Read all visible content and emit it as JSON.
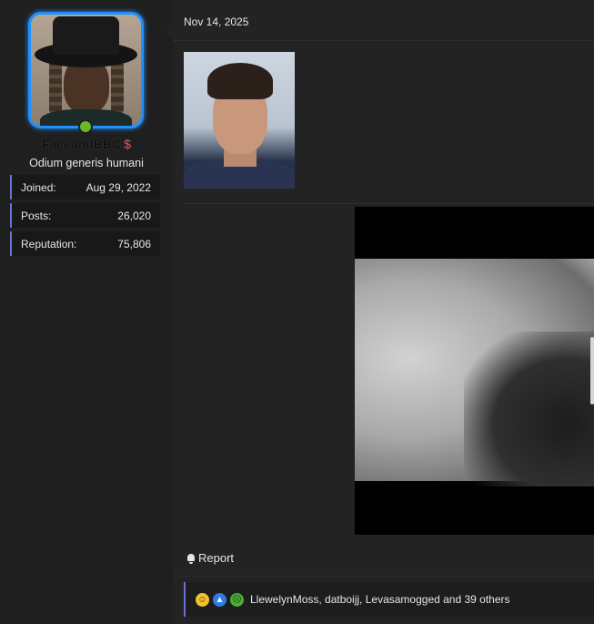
{
  "user": {
    "name": "FaceandBBC",
    "badge_icon": "dollar-badge-icon",
    "title": "Odium generis humani",
    "online": true,
    "stats": [
      {
        "label": "Joined:",
        "value": "Aug 29, 2022"
      },
      {
        "label": "Posts:",
        "value": "26,020"
      },
      {
        "label": "Reputation:",
        "value": "75,806"
      }
    ]
  },
  "post": {
    "date": "Nov 14, 2025",
    "report_label": "Report",
    "reactions": {
      "icons": [
        "laugh-reaction-icon",
        "like-reaction-icon",
        "sick-reaction-icon"
      ],
      "text": "LlewelynMoss, datboijj, Levasamogged and 39 others"
    }
  },
  "colors": {
    "avatar_border": "#1e90ff",
    "online": "#6ab82e",
    "stat_accent": "#6a6fd8"
  }
}
